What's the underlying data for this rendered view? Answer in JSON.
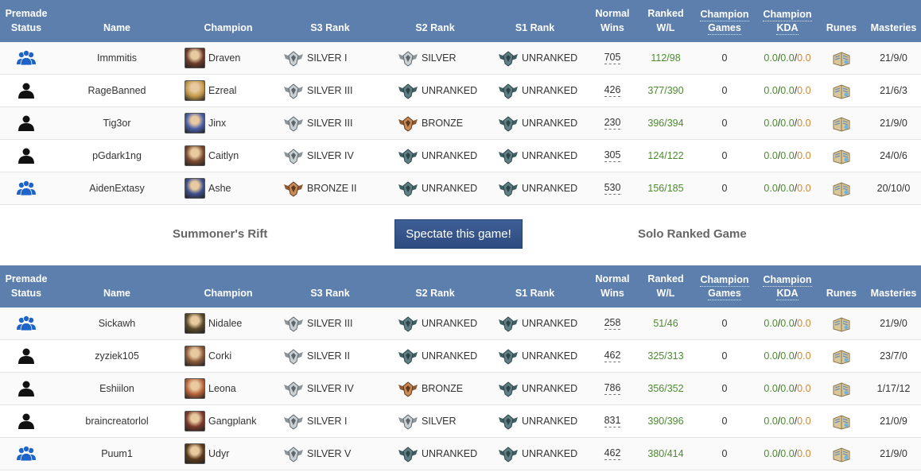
{
  "headers": {
    "premade_1": "Premade",
    "premade_2": "Status",
    "name": "Name",
    "champion": "Champion",
    "s3": "S3 Rank",
    "s2": "S2 Rank",
    "s1": "S1 Rank",
    "normal_1": "Normal",
    "normal_2": "Wins",
    "ranked_1": "Ranked",
    "ranked_2": "W/L",
    "cg_1": "Champion",
    "cg_2": "Games",
    "kda_1": "Champion",
    "kda_2": "KDA",
    "runes": "Runes",
    "masteries": "Masteries"
  },
  "colors": {
    "header_bg": "#5d7fad",
    "premade_blue": "#1e63c9",
    "solo_black": "#111111",
    "winloss_green": "#4c8a2f",
    "kda_orange": "#d4872a",
    "button_blue": "#2e4b7f"
  },
  "middle": {
    "map": "Summoner's Rift",
    "spectate": "Spectate this game!",
    "queue": "Solo Ranked Game"
  },
  "teams": [
    {
      "players": [
        {
          "premade": "group-icon",
          "name": "Immmitis",
          "champion": "Draven",
          "s3": "SILVER I",
          "s3_tier": "silver",
          "s2": "SILVER",
          "s2_tier": "silver",
          "s1": "UNRANKED",
          "s1_tier": "unranked",
          "normal_wins": "705",
          "ranked_wl": "112/98",
          "champ_games": "0",
          "kda_k": "0.0",
          "kda_d": "0.0",
          "kda_a": "0.0",
          "masteries": "21/9/0"
        },
        {
          "premade": "solo-icon",
          "name": "RageBanned",
          "champion": "Ezreal",
          "s3": "SILVER III",
          "s3_tier": "silver",
          "s2": "UNRANKED",
          "s2_tier": "unranked",
          "s1": "UNRANKED",
          "s1_tier": "unranked",
          "normal_wins": "426",
          "ranked_wl": "377/390",
          "champ_games": "0",
          "kda_k": "0.0",
          "kda_d": "0.0",
          "kda_a": "0.0",
          "masteries": "21/6/3"
        },
        {
          "premade": "solo-icon",
          "name": "Tig3or",
          "champion": "Jinx",
          "s3": "SILVER III",
          "s3_tier": "silver",
          "s2": "BRONZE",
          "s2_tier": "bronze",
          "s1": "UNRANKED",
          "s1_tier": "unranked",
          "normal_wins": "230",
          "ranked_wl": "396/394",
          "champ_games": "0",
          "kda_k": "0.0",
          "kda_d": "0.0",
          "kda_a": "0.0",
          "masteries": "21/9/0"
        },
        {
          "premade": "solo-icon",
          "name": "pGdark1ng",
          "champion": "Caitlyn",
          "s3": "SILVER IV",
          "s3_tier": "silver",
          "s2": "UNRANKED",
          "s2_tier": "unranked",
          "s1": "UNRANKED",
          "s1_tier": "unranked",
          "normal_wins": "305",
          "ranked_wl": "124/122",
          "champ_games": "0",
          "kda_k": "0.0",
          "kda_d": "0.0",
          "kda_a": "0.0",
          "masteries": "24/0/6"
        },
        {
          "premade": "group-icon",
          "name": "AidenExtasy",
          "champion": "Ashe",
          "s3": "BRONZE II",
          "s3_tier": "bronze",
          "s2": "UNRANKED",
          "s2_tier": "unranked",
          "s1": "UNRANKED",
          "s1_tier": "unranked",
          "normal_wins": "530",
          "ranked_wl": "156/185",
          "champ_games": "0",
          "kda_k": "0.0",
          "kda_d": "0.0",
          "kda_a": "0.0",
          "masteries": "20/10/0"
        }
      ]
    },
    {
      "players": [
        {
          "premade": "group-icon",
          "name": "Sickawh",
          "champion": "Nidalee",
          "s3": "SILVER III",
          "s3_tier": "silver",
          "s2": "UNRANKED",
          "s2_tier": "unranked",
          "s1": "UNRANKED",
          "s1_tier": "unranked",
          "normal_wins": "258",
          "ranked_wl": "51/46",
          "champ_games": "0",
          "kda_k": "0.0",
          "kda_d": "0.0",
          "kda_a": "0.0",
          "masteries": "21/9/0"
        },
        {
          "premade": "solo-icon",
          "name": "zyziek105",
          "champion": "Corki",
          "s3": "SILVER II",
          "s3_tier": "silver",
          "s2": "UNRANKED",
          "s2_tier": "unranked",
          "s1": "UNRANKED",
          "s1_tier": "unranked",
          "normal_wins": "462",
          "ranked_wl": "325/313",
          "champ_games": "0",
          "kda_k": "0.0",
          "kda_d": "0.0",
          "kda_a": "0.0",
          "masteries": "23/7/0"
        },
        {
          "premade": "solo-icon",
          "name": "Eshiilon",
          "champion": "Leona",
          "s3": "SILVER IV",
          "s3_tier": "silver",
          "s2": "BRONZE",
          "s2_tier": "bronze",
          "s1": "UNRANKED",
          "s1_tier": "unranked",
          "normal_wins": "786",
          "ranked_wl": "356/352",
          "champ_games": "0",
          "kda_k": "0.0",
          "kda_d": "0.0",
          "kda_a": "0.0",
          "masteries": "1/17/12"
        },
        {
          "premade": "solo-icon",
          "name": "braincreatorlol",
          "champion": "Gangplank",
          "s3": "SILVER I",
          "s3_tier": "silver",
          "s2": "SILVER",
          "s2_tier": "silver",
          "s1": "UNRANKED",
          "s1_tier": "unranked",
          "normal_wins": "831",
          "ranked_wl": "390/396",
          "champ_games": "0",
          "kda_k": "0.0",
          "kda_d": "0.0",
          "kda_a": "0.0",
          "masteries": "21/0/9"
        },
        {
          "premade": "group-icon",
          "name": "Puum1",
          "champion": "Udyr",
          "s3": "SILVER V",
          "s3_tier": "silver",
          "s2": "UNRANKED",
          "s2_tier": "unranked",
          "s1": "UNRANKED",
          "s1_tier": "unranked",
          "normal_wins": "462",
          "ranked_wl": "380/414",
          "champ_games": "0",
          "kda_k": "0.0",
          "kda_d": "0.0",
          "kda_a": "0.0",
          "masteries": "21/9/0"
        }
      ]
    }
  ]
}
